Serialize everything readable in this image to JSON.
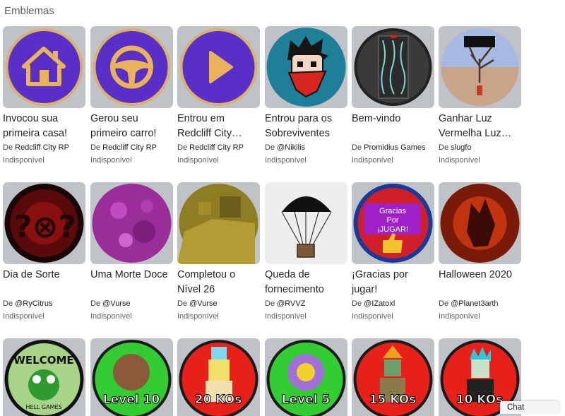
{
  "section": {
    "title": "Emblemas"
  },
  "by_prefix": "De",
  "rows": [
    {
      "badges": [
        {
          "name": "Invocou sua primeira casa!",
          "creator": "Redcliff City RP",
          "status": "Indisponível",
          "icon": "house-icon"
        },
        {
          "name": "Gerou seu primeiro carro!",
          "creator": "Redcliff City RP",
          "status": "Indisponível",
          "icon": "steering-wheel-icon"
        },
        {
          "name": "Entrou em Redcliff City…",
          "creator": "Redcliff City RP",
          "status": "Indisponível",
          "icon": "play-icon"
        },
        {
          "name": "Entrou para os Sobreviventes",
          "creator": "@Nikilis",
          "status": "Indisponível",
          "icon": "survivor-face-icon"
        },
        {
          "name": "Bem-vindo",
          "creator": "Promidius Games",
          "status": "Indisponível",
          "icon": "door-icon"
        },
        {
          "name": "Ganhar Luz Vermelha Luz…",
          "creator": "slugfo",
          "status": "Indisponível",
          "icon": "red-light-tree-icon"
        }
      ]
    },
    {
      "badges": [
        {
          "name": "Dia de Sorte",
          "creator": "@RyCitrus",
          "status": "Indisponível",
          "icon": "dice-icon"
        },
        {
          "name": "Uma Morte Doce",
          "creator": "@Vurse",
          "status": "Indisponível",
          "icon": "pink-texture-icon"
        },
        {
          "name": "Completou o Nível 26",
          "creator": "@Vurse",
          "status": "Indisponível",
          "icon": "level-26-icon"
        },
        {
          "name": "Queda de fornecimento",
          "creator": "@RVVZ",
          "status": "Indisponível",
          "icon": "parachute-crate-icon"
        },
        {
          "name": "¡Gracias por jugar!",
          "creator": "@IZatoxl",
          "status": "Indisponível",
          "icon": "thumbs-up-icon",
          "text": [
            "Gracias",
            "Por",
            "¡JUGAR!"
          ]
        },
        {
          "name": "Halloween 2020",
          "creator": "@Planet3arth",
          "status": "Indisponível",
          "icon": "halloween-icon"
        }
      ]
    },
    {
      "badges": [
        {
          "icon": "welcome-frog-icon",
          "text": [
            "WELCOME",
            "HELL GAMES"
          ]
        },
        {
          "icon": "level-10-icon",
          "text": [
            "Level 10"
          ]
        },
        {
          "icon": "20-kos-icon",
          "text": [
            "20 KOs"
          ]
        },
        {
          "icon": "level-5-icon",
          "text": [
            "Level 5"
          ]
        },
        {
          "icon": "15-kos-icon",
          "text": [
            "15 KOs"
          ]
        },
        {
          "icon": "10-kos-icon",
          "text": [
            "10 KOs"
          ]
        }
      ]
    }
  ],
  "chat": {
    "label": "Chat"
  },
  "colors": {
    "purple": "#5a2fc8",
    "gold": "#d9b16a",
    "green": "#33cc33",
    "red": "#e8201a"
  }
}
